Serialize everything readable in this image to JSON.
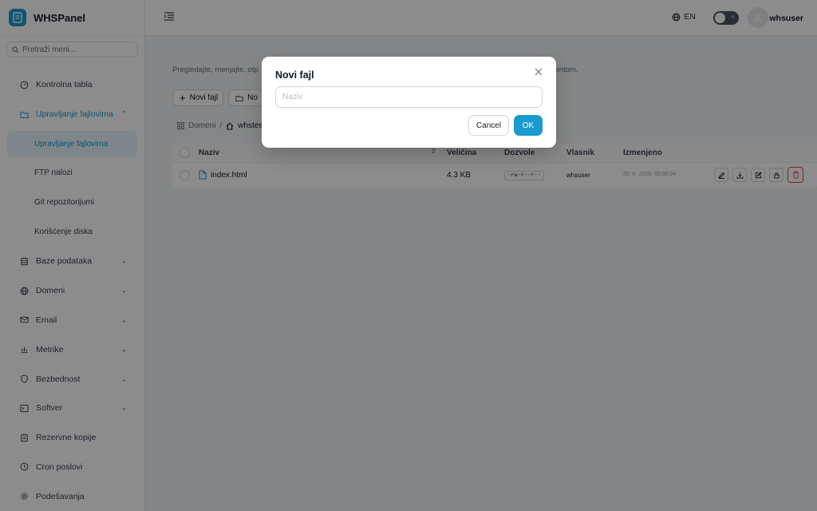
{
  "brand": {
    "name": "WHSPanel"
  },
  "search": {
    "placeholder": "Pretraži meni..."
  },
  "sidebar": {
    "items": [
      {
        "label": "Kontrolna tabla",
        "icon": "dashboard-icon"
      },
      {
        "label": "Upravljanje fajlovima",
        "icon": "folder-icon",
        "expanded": true,
        "children": [
          "Upravljanje fajlovima",
          "FTP nalozi",
          "Git repozitorijumi",
          "Korišćenje diska"
        ]
      },
      {
        "label": "Baze podataka",
        "icon": "database-icon"
      },
      {
        "label": "Domeni",
        "icon": "globe-icon"
      },
      {
        "label": "Email",
        "icon": "mail-icon"
      },
      {
        "label": "Metrike",
        "icon": "chart-icon"
      },
      {
        "label": "Bezbednost",
        "icon": "shield-icon"
      },
      {
        "label": "Softver",
        "icon": "terminal-icon"
      },
      {
        "label": "Rezervne kopije",
        "icon": "backup-icon"
      },
      {
        "label": "Cron poslovi",
        "icon": "clock-icon"
      },
      {
        "label": "Podešavanja",
        "icon": "gear-icon"
      }
    ]
  },
  "header": {
    "language": "EN",
    "username": "whsuser"
  },
  "main": {
    "description_left": "Pregledajte, menjajte, otp",
    "description_right": "otrebe za FTP klijentom.",
    "toolbar": {
      "new_file": "Novi fajl",
      "new_folder_partial": "No"
    },
    "breadcrumb": {
      "root": "Domeni",
      "separator": "/",
      "current_partial": "whstes"
    },
    "table": {
      "columns": {
        "name": "Naziv",
        "size": "Veličina",
        "permissions": "Dozvole",
        "owner": "Vlasnik",
        "modified": "Izmenjeno"
      },
      "rows": [
        {
          "name": "index.html",
          "size": "4.3 KB",
          "permissions": "-rw-r--r--",
          "owner": "whsuser",
          "modified": "20. 8. 2026. 00:00:04"
        }
      ]
    }
  },
  "modal": {
    "title": "Novi fajl",
    "input_placeholder": "Naziv",
    "input_value": "",
    "cancel_label": "Cancel",
    "ok_label": "OK"
  },
  "colors": {
    "accent": "#1a9bd0",
    "danger": "#ef4444",
    "overlay": "rgba(0,0,0,0.45)"
  }
}
